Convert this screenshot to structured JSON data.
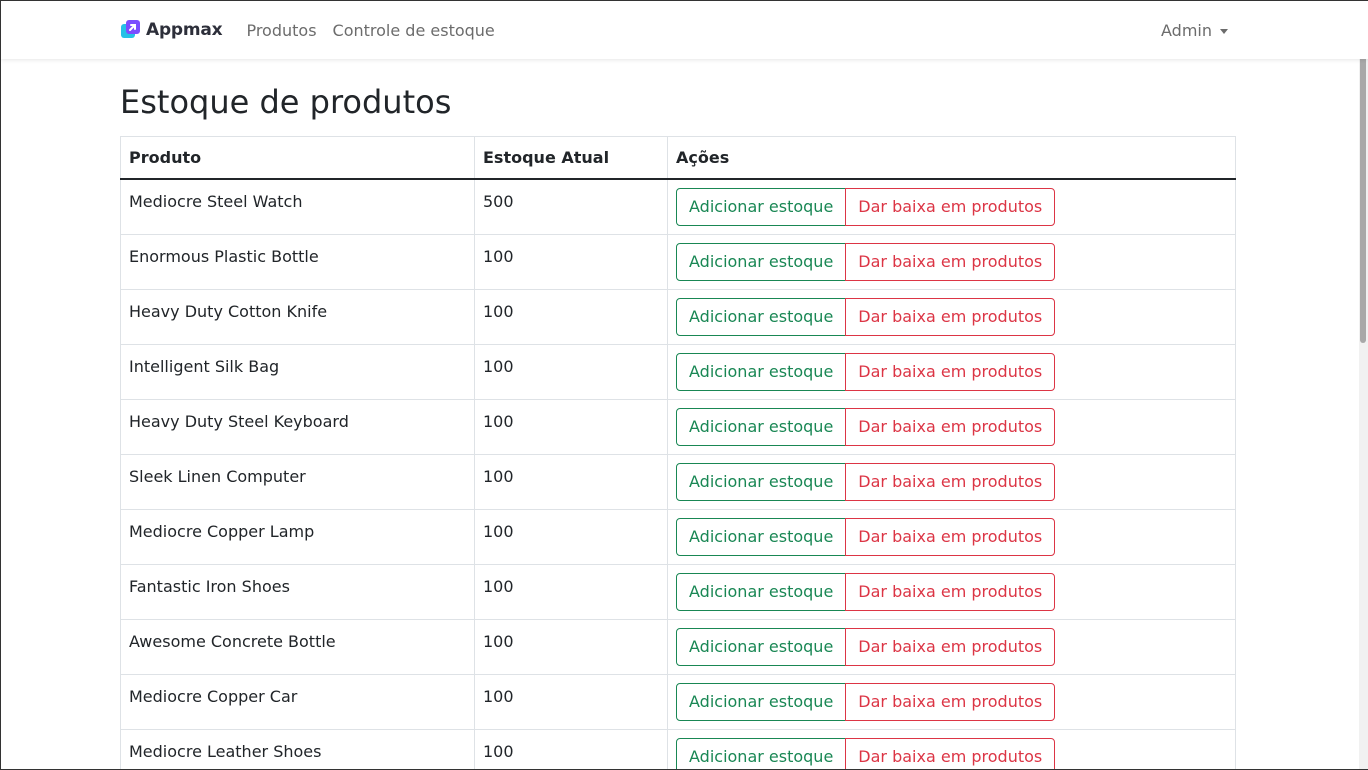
{
  "navbar": {
    "brand": "Appmax",
    "links": [
      "Produtos",
      "Controle de estoque"
    ],
    "user_menu": "Admin"
  },
  "page": {
    "title": "Estoque de produtos"
  },
  "table": {
    "headers": [
      "Produto",
      "Estoque Atual",
      "Ações"
    ],
    "add_label": "Adicionar estoque",
    "remove_label": "Dar baixa em produtos",
    "rows": [
      {
        "product": "Mediocre Steel Watch",
        "stock": "500"
      },
      {
        "product": "Enormous Plastic Bottle",
        "stock": "100"
      },
      {
        "product": "Heavy Duty Cotton Knife",
        "stock": "100"
      },
      {
        "product": "Intelligent Silk Bag",
        "stock": "100"
      },
      {
        "product": "Heavy Duty Steel Keyboard",
        "stock": "100"
      },
      {
        "product": "Sleek Linen Computer",
        "stock": "100"
      },
      {
        "product": "Mediocre Copper Lamp",
        "stock": "100"
      },
      {
        "product": "Fantastic Iron Shoes",
        "stock": "100"
      },
      {
        "product": "Awesome Concrete Bottle",
        "stock": "100"
      },
      {
        "product": "Mediocre Copper Car",
        "stock": "100"
      },
      {
        "product": "Mediocre Leather Shoes",
        "stock": "100"
      }
    ]
  },
  "colors": {
    "success": "#198754",
    "danger": "#dc3545",
    "logo_purple": "#7b4dff",
    "logo_cyan": "#27c1e6"
  },
  "icons": {
    "logo": "appmax-logo-icon",
    "dropdown": "caret-down-icon"
  }
}
